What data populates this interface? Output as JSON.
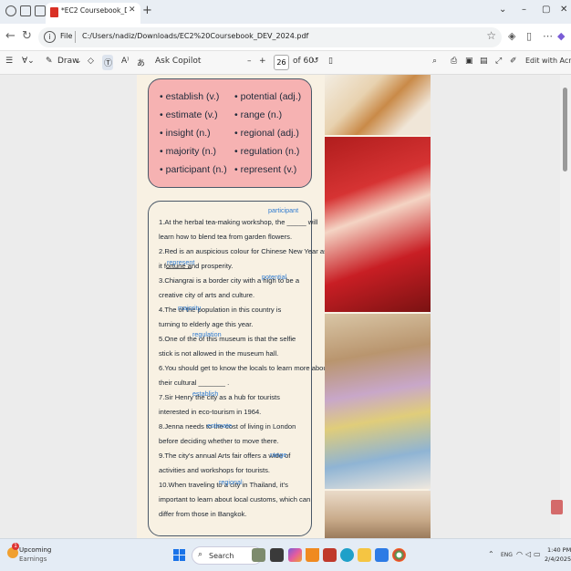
{
  "browser": {
    "tab_title": "*EC2 Coursebook_DEV_2024.pdf",
    "tab_close": "✕",
    "new_tab": "+",
    "address_label": "File",
    "address_path": "C:/Users/nadiz/Downloads/EC2%20Coursebook_DEV_2024.pdf",
    "window_controls": [
      "⌄",
      "–",
      "▢",
      "✕"
    ]
  },
  "pdf_toolbar": {
    "draw_label": "Draw",
    "ask_copilot": "Ask Copilot",
    "zoom_out": "–",
    "zoom_in": "+",
    "page_current": "26",
    "page_total": "of 60",
    "edit_with_acrobat": "Edit with Acrobat"
  },
  "vocab": {
    "left": [
      "establish (v.)",
      "estimate (v.)",
      "insight (n.)",
      "majority (n.)",
      "participant (n.)"
    ],
    "right": [
      "potential (adj.)",
      "range (n.)",
      "regional (adj.)",
      "regulation (n.)",
      "represent (v.)"
    ],
    "bullet": "•"
  },
  "exercise": {
    "lines": [
      "1.At the herbal tea-making workshop, the _____ will",
      "learn how to blend tea from garden flowers.",
      "2.Red is an auspicious colour for Chinese New Year as",
      "it              fortune and prosperity.",
      "3.Chiangrai is a border city with a high            to be a",
      "creative city of arts and culture.",
      "4.The              of the population in this country is",
      "turning to elderly age this year.",
      "5.One of the                of this museum is that the selfie",
      "stick is not allowed in the museum hall.",
      "6.You should get to know the locals to learn more about",
      "their cultural _______ .",
      "7.Sir Henry              the city as a hub for tourists",
      "interested in eco-tourism in 1964.",
      "8.Jenna needs to             the cost of living in London",
      "before deciding whether to move there.",
      "9.The city's annual Arts fair offers a wide              of",
      "activities and workshops for tourists.",
      "10.When traveling to a                 city in Thailand, it's",
      "important to learn about local customs, which can",
      "differ from those in Bangkok."
    ],
    "answers": [
      "participant",
      "represent",
      "potential",
      "majority",
      "regulation",
      "establish",
      "estimate",
      "range",
      "regional"
    ]
  },
  "taskbar": {
    "weather_badge": "1",
    "weather_title": "Upcoming",
    "weather_sub": "Earnings",
    "search_placeholder": "Search",
    "language": "ENG",
    "time": "1:40 PM",
    "date": "2/4/2025"
  }
}
